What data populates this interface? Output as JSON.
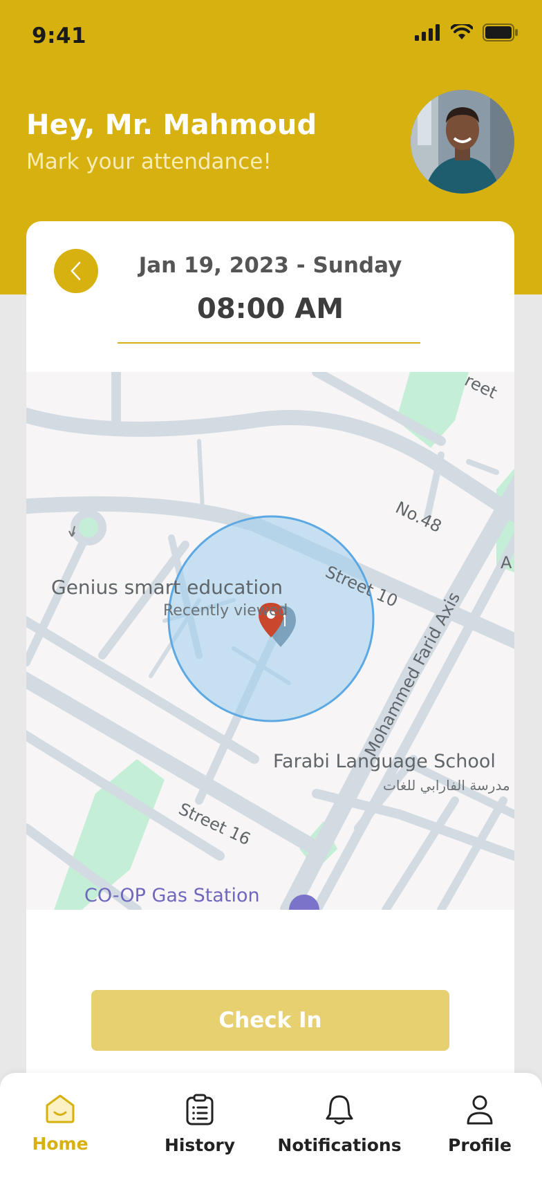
{
  "status_bar": {
    "time": "9:41"
  },
  "header": {
    "greeting": "Hey, Mr. Mahmoud",
    "subtitle": "Mark your attendance!"
  },
  "attendance": {
    "date": "Jan 19, 2023 - Sunday",
    "time": "08:00 AM"
  },
  "map": {
    "labels": {
      "genius": "Genius smart education",
      "recently_viewed": "Recently viewed",
      "street10": "Street 10",
      "no48": "No.48",
      "mohammed": "Mohammed Farid Axis",
      "farabi": "Farabi Language School",
      "farabi_ar": "مدرسة الفارابي للغات",
      "street16": "Street 16",
      "coop": "CO-OP Gas Station",
      "street_top": "reet",
      "a_label": "A"
    }
  },
  "actions": {
    "check_in": "Check In"
  },
  "nav": {
    "items": [
      {
        "label": "Home",
        "icon": "home-icon",
        "active": true
      },
      {
        "label": "History",
        "icon": "clipboard-list-icon",
        "active": false
      },
      {
        "label": "Notifications",
        "icon": "bell-icon",
        "active": false
      },
      {
        "label": "Profile",
        "icon": "user-icon",
        "active": false
      }
    ]
  },
  "colors": {
    "accent": "#d6b10f",
    "accent_light": "#e6d070",
    "map_circle": "#9fcdef",
    "pin": "#c9472c"
  }
}
